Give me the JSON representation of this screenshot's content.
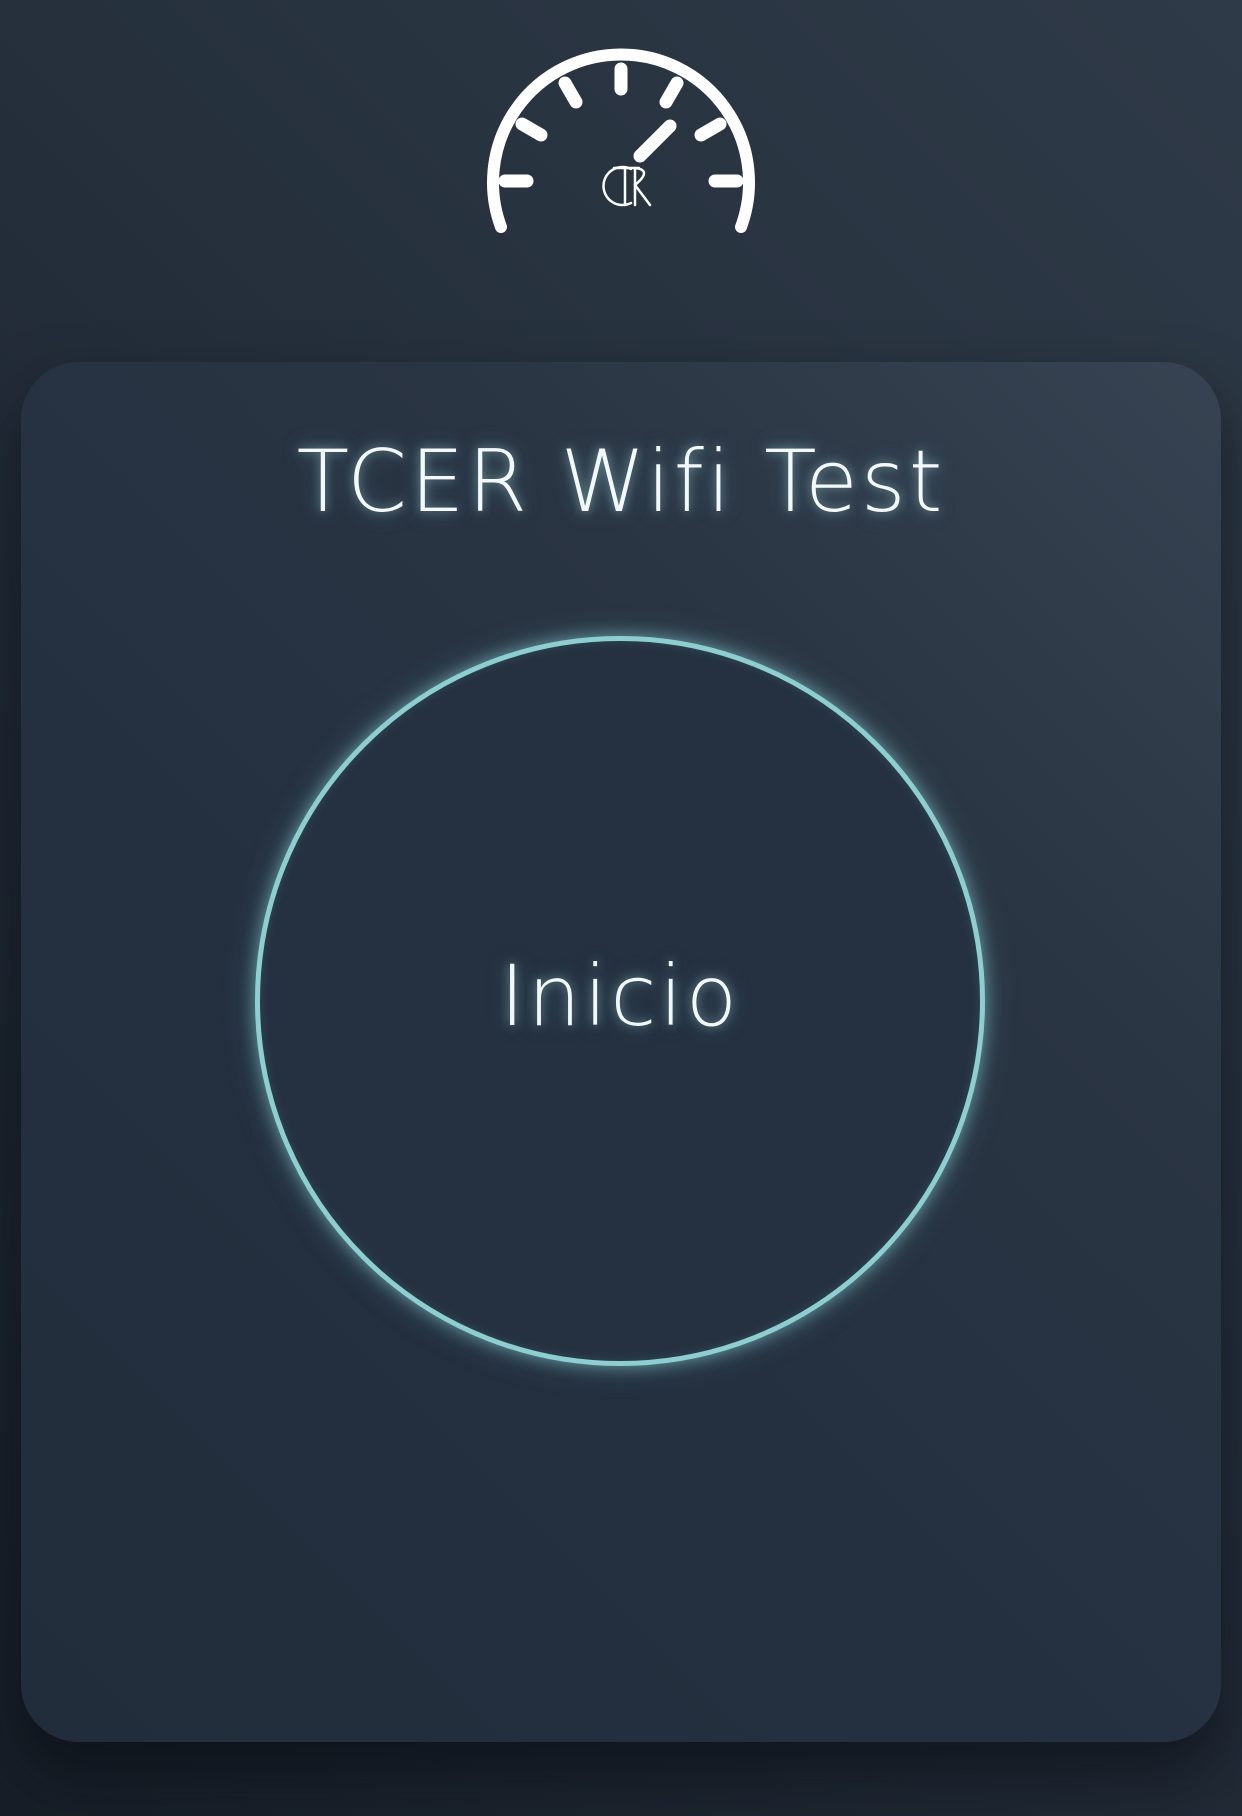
{
  "header": {
    "logo_icon": "speedometer-icon",
    "logo_monogram": "TCER"
  },
  "card": {
    "title": "TCER Wifi Test",
    "start_button_label": "Inicio"
  },
  "colors": {
    "background": "#1f2833",
    "card": "#283442",
    "accent_ring": "#8ccfd1",
    "text": "#f4f8fa"
  }
}
